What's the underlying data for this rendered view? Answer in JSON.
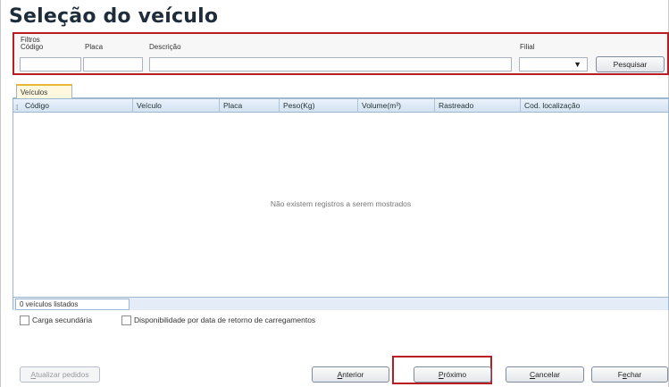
{
  "window": {
    "title": "Seleção do veículo"
  },
  "filters": {
    "group_label": "Filtros",
    "codigo_label": "Código",
    "placa_label": "Placa",
    "descricao_label": "Descrição",
    "filial_label": "Filial",
    "codigo_value": "",
    "placa_value": "",
    "descricao_value": "",
    "filial_value": "",
    "search_button": "Pesquisar",
    "dropdown_icon": "chevron-down-icon"
  },
  "tabs": [
    {
      "label": "Veículos",
      "active": true
    }
  ],
  "grid": {
    "columns": [
      "Código",
      "Veículo",
      "Placa",
      "Peso(Kg)",
      "Volume(m³)",
      "Rastreado",
      "Cod. localização"
    ],
    "rows": [],
    "empty_message": "Não existem registros a serem mostrados",
    "count_text": "0 veículos listados"
  },
  "options": {
    "carga_secundaria": {
      "label": "Carga secundária",
      "checked": false
    },
    "disponibilidade": {
      "label": "Disponibilidade por data de retorno de carregamentos",
      "checked": false
    }
  },
  "buttons": {
    "update_orders": {
      "mnemonic": "A",
      "rest": "tualizar pedidos",
      "enabled": false
    },
    "previous": {
      "mnemonic": "A",
      "rest": "nterior"
    },
    "next": {
      "mnemonic": "P",
      "rest": "róximo"
    },
    "cancel": {
      "mnemonic": "C",
      "rest": "ancelar"
    },
    "close": {
      "pre": "F",
      "mnemonic": "e",
      "rest": "char"
    }
  },
  "colors": {
    "highlight": "#b91d22",
    "tab_accent": "#e7b935",
    "grid_header": "#d3e2f2"
  }
}
